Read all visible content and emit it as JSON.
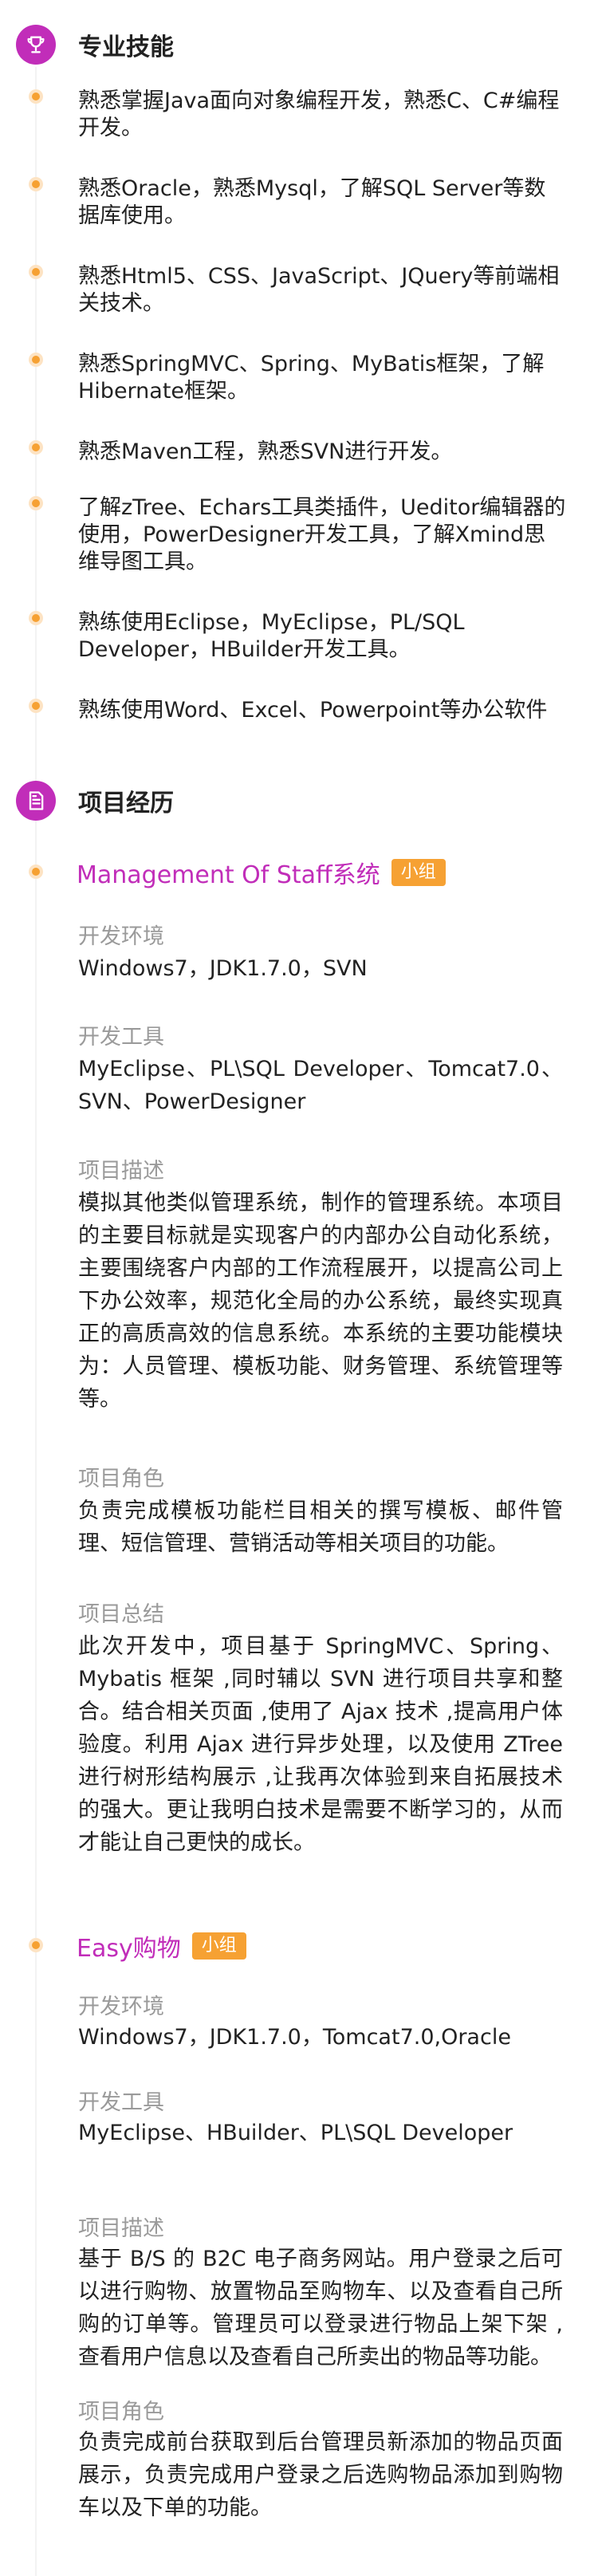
{
  "skills_section": {
    "title": "专业技能",
    "icon": "trophy-icon",
    "items": [
      "熟悉掌握Java面向对象编程开发，熟悉C、C#编程开发。",
      "熟悉Oracle，熟悉Mysql，了解SQL Server等数据库使用。",
      "熟悉Html5、CSS、JavaScript、JQuery等前端相关技术。",
      "熟悉SpringMVC、Spring、MyBatis框架，了解Hibernate框架。",
      "熟悉Maven工程，熟悉SVN进行开发。",
      "了解zTree、Echars工具类插件，Ueditor编辑器的使用，PowerDesigner开发工具，了解Xmind思维导图工具。",
      "熟练使用Eclipse，MyEclipse，PL/SQL Developer，HBuilder开发工具。",
      "熟练使用Word、Excel、Powerpoint等办公软件"
    ]
  },
  "projects_section": {
    "title": "项目经历",
    "icon": "document-icon",
    "projects": [
      {
        "name": "Management Of Staff系统",
        "badge": "小组",
        "fields": [
          {
            "label": "开发环境",
            "value": "Windows7，JDK1.7.0，SVN"
          },
          {
            "label": "开发工具",
            "value": "MyEclipse、PL\\SQL Developer、Tomcat7.0、SVN、PowerDesigner"
          },
          {
            "label": "项目描述",
            "value": "模拟其他类似管理系统，制作的管理系统。本项目的主要目标就是实现客户的内部办公自动化系统，主要围绕客户内部的工作流程展开，以提高公司上下办公效率，规范化全局的办公系统，最终实现真正的高质高效的信息系统。本系统的主要功能模块为：人员管理、模板功能、财务管理、系统管理等等。"
          },
          {
            "label": "项目角色",
            "value": "负责完成模板功能栏目相关的撰写模板、邮件管理、短信管理、营销活动等相关项目的功能。"
          },
          {
            "label": "项目总结",
            "value": "此次开发中，项目基于 SpringMVC、Spring、Mybatis 框架 ,同时辅以 SVN 进行项目共享和整合。结合相关页面 ,使用了 Ajax 技术 ,提高用户体验度。利用 Ajax 进行异步处理，以及使用 ZTree 进行树形结构展示 ,让我再次体验到来自拓展技术的强大。更让我明白技术是需要不断学习的，从而才能让自己更快的成长。"
          }
        ]
      },
      {
        "name": "Easy购物",
        "badge": "小组",
        "fields": [
          {
            "label": "开发环境",
            "value": "Windows7，JDK1.7.0，Tomcat7.0,Oracle"
          },
          {
            "label": "开发工具",
            "value": "MyEclipse、HBuilder、PL\\SQL Developer"
          },
          {
            "label": "项目描述",
            "value": "基于 B/S 的 B2C 电子商务网站。用户登录之后可以进行购物、放置物品至购物车、以及查看自己所购的订单等。管理员可以登录进行物品上架下架 ,查看用户信息以及查看自己所卖出的物品等功能。"
          },
          {
            "label": "项目角色",
            "value": "负责完成前台获取到后台管理员新添加的物品页面展示，负责完成用户登录之后选购物品添加到购物车以及下单的功能。"
          }
        ]
      }
    ]
  },
  "colors": {
    "accent": "#c12db9",
    "badge": "#f6a133",
    "dot_outer": "#fde3c3",
    "dot_inner": "#f6a133",
    "label_gray": "#9a9a9a",
    "text": "#222222"
  }
}
